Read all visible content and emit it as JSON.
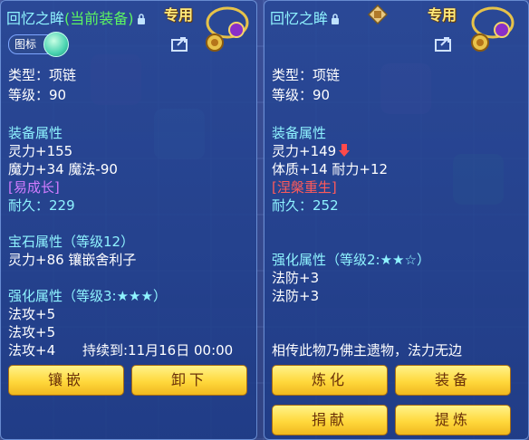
{
  "left": {
    "title_name": "回忆之眸",
    "title_tag": "(当前装备)",
    "special_label": "专用",
    "badge_label": "图标",
    "type_line": "类型：项链",
    "level_line": "等级：90",
    "equip_header": "装备属性",
    "equip_attr1": "灵力+155",
    "equip_attr2": "魔力+34 魔法-90",
    "growth_tag": "[易成长]",
    "durability": "耐久：229",
    "gem_header": "宝石属性（等级12）",
    "gem_attr": "灵力+86 镶嵌舍利子",
    "enhance_header": "强化属性（等级3:★★★）",
    "enhance_attr1": "法攻+5",
    "enhance_attr2": "法攻+5",
    "enhance_attr3": "法攻+4",
    "duration": "持续到:11月16日 00:00",
    "btn_inlay": "镶嵌",
    "btn_unequip": "卸下"
  },
  "right": {
    "title_name": "回忆之眸",
    "special_label": "专用",
    "type_line": "类型：项链",
    "level_line": "等级：90",
    "equip_header": "装备属性",
    "equip_attr1": "灵力+149",
    "equip_attr2": "体质+14 耐力+12",
    "rebirth_tag": "[涅槃重生]",
    "durability": "耐久：252",
    "enhance_header": "强化属性（等级2:★★☆）",
    "enhance_attr1": "法防+3",
    "enhance_attr2": "法防+3",
    "legend": "相传此物乃佛主遗物，法力无边",
    "btn_refine": "炼化",
    "btn_equip": "装备",
    "btn_donate": "捐献",
    "btn_extract": "提炼"
  },
  "colors": {
    "panel": "#2c4c98",
    "cyan": "#8ff3ff",
    "green": "#5cf562",
    "purple": "#d17cff",
    "red": "#ff5a5a",
    "button": "#ffd83c"
  },
  "icons": [
    "lock-icon",
    "necklace-icon",
    "share-icon",
    "down-arrow-icon",
    "seal-icon"
  ]
}
